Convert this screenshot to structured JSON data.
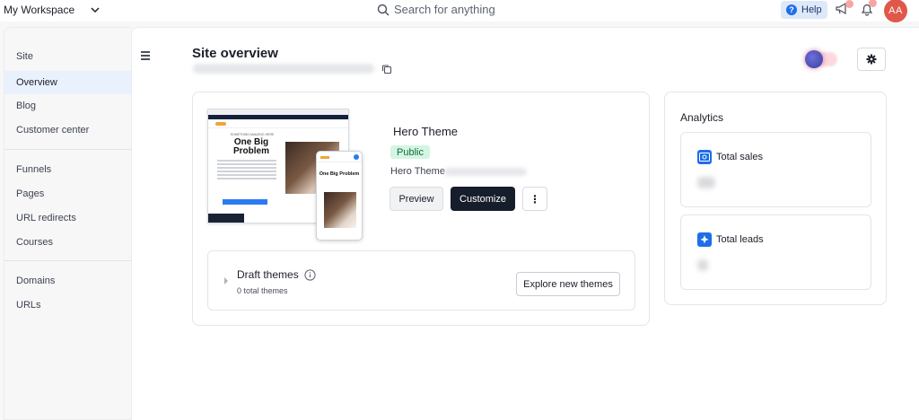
{
  "topbar": {
    "workspace_label": "My Workspace",
    "search_placeholder": "Search for anything",
    "help_label": "Help",
    "avatar_initials": "AA"
  },
  "sidebar": {
    "items": [
      {
        "label": "Site",
        "active": false
      },
      {
        "label": "Overview",
        "active": true
      },
      {
        "label": "Blog",
        "active": false
      },
      {
        "label": "Customer center",
        "active": false
      },
      {
        "label": "Funnels",
        "active": false
      },
      {
        "label": "Pages",
        "active": false
      },
      {
        "label": "URL redirects",
        "active": false
      },
      {
        "label": "Courses",
        "active": false
      },
      {
        "label": "Domains",
        "active": false
      },
      {
        "label": "URLs",
        "active": false
      }
    ]
  },
  "main": {
    "title": "Site overview"
  },
  "theme": {
    "name": "Hero Theme",
    "status": "Public",
    "subtitle": "Hero Theme",
    "preview_label": "Preview",
    "customize_label": "Customize",
    "more_label": "⋮",
    "mock_title": "One Big Problem",
    "mock_small": "SOMETHING AMAZING HERE"
  },
  "drafts": {
    "title": "Draft themes",
    "count_text": "0 total themes",
    "explore_label": "Explore new themes"
  },
  "analytics": {
    "title": "Analytics",
    "metrics": [
      {
        "label": "Total sales",
        "icon": "dollar-icon"
      },
      {
        "label": "Total leads",
        "icon": "sparkle-icon"
      }
    ]
  },
  "colors": {
    "accent": "#1e6ee8",
    "primary_button": "#161d2b",
    "badge_bg": "#d4f5e3",
    "avatar": "#e0584a"
  }
}
